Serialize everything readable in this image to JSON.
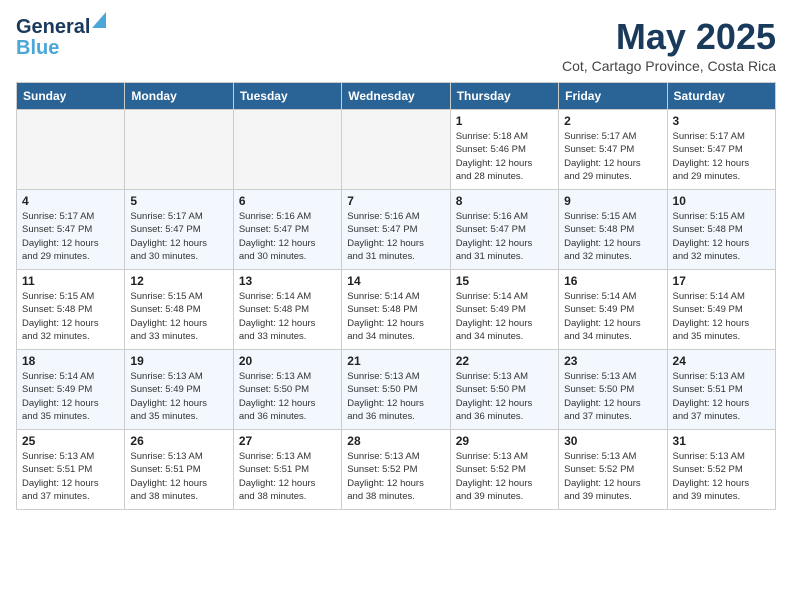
{
  "header": {
    "logo_line1": "General",
    "logo_line2": "Blue",
    "month": "May 2025",
    "location": "Cot, Cartago Province, Costa Rica"
  },
  "columns": [
    "Sunday",
    "Monday",
    "Tuesday",
    "Wednesday",
    "Thursday",
    "Friday",
    "Saturday"
  ],
  "weeks": [
    [
      {
        "day": "",
        "detail": ""
      },
      {
        "day": "",
        "detail": ""
      },
      {
        "day": "",
        "detail": ""
      },
      {
        "day": "",
        "detail": ""
      },
      {
        "day": "1",
        "detail": "Sunrise: 5:18 AM\nSunset: 5:46 PM\nDaylight: 12 hours\nand 28 minutes."
      },
      {
        "day": "2",
        "detail": "Sunrise: 5:17 AM\nSunset: 5:47 PM\nDaylight: 12 hours\nand 29 minutes."
      },
      {
        "day": "3",
        "detail": "Sunrise: 5:17 AM\nSunset: 5:47 PM\nDaylight: 12 hours\nand 29 minutes."
      }
    ],
    [
      {
        "day": "4",
        "detail": "Sunrise: 5:17 AM\nSunset: 5:47 PM\nDaylight: 12 hours\nand 29 minutes."
      },
      {
        "day": "5",
        "detail": "Sunrise: 5:17 AM\nSunset: 5:47 PM\nDaylight: 12 hours\nand 30 minutes."
      },
      {
        "day": "6",
        "detail": "Sunrise: 5:16 AM\nSunset: 5:47 PM\nDaylight: 12 hours\nand 30 minutes."
      },
      {
        "day": "7",
        "detail": "Sunrise: 5:16 AM\nSunset: 5:47 PM\nDaylight: 12 hours\nand 31 minutes."
      },
      {
        "day": "8",
        "detail": "Sunrise: 5:16 AM\nSunset: 5:47 PM\nDaylight: 12 hours\nand 31 minutes."
      },
      {
        "day": "9",
        "detail": "Sunrise: 5:15 AM\nSunset: 5:48 PM\nDaylight: 12 hours\nand 32 minutes."
      },
      {
        "day": "10",
        "detail": "Sunrise: 5:15 AM\nSunset: 5:48 PM\nDaylight: 12 hours\nand 32 minutes."
      }
    ],
    [
      {
        "day": "11",
        "detail": "Sunrise: 5:15 AM\nSunset: 5:48 PM\nDaylight: 12 hours\nand 32 minutes."
      },
      {
        "day": "12",
        "detail": "Sunrise: 5:15 AM\nSunset: 5:48 PM\nDaylight: 12 hours\nand 33 minutes."
      },
      {
        "day": "13",
        "detail": "Sunrise: 5:14 AM\nSunset: 5:48 PM\nDaylight: 12 hours\nand 33 minutes."
      },
      {
        "day": "14",
        "detail": "Sunrise: 5:14 AM\nSunset: 5:48 PM\nDaylight: 12 hours\nand 34 minutes."
      },
      {
        "day": "15",
        "detail": "Sunrise: 5:14 AM\nSunset: 5:49 PM\nDaylight: 12 hours\nand 34 minutes."
      },
      {
        "day": "16",
        "detail": "Sunrise: 5:14 AM\nSunset: 5:49 PM\nDaylight: 12 hours\nand 34 minutes."
      },
      {
        "day": "17",
        "detail": "Sunrise: 5:14 AM\nSunset: 5:49 PM\nDaylight: 12 hours\nand 35 minutes."
      }
    ],
    [
      {
        "day": "18",
        "detail": "Sunrise: 5:14 AM\nSunset: 5:49 PM\nDaylight: 12 hours\nand 35 minutes."
      },
      {
        "day": "19",
        "detail": "Sunrise: 5:13 AM\nSunset: 5:49 PM\nDaylight: 12 hours\nand 35 minutes."
      },
      {
        "day": "20",
        "detail": "Sunrise: 5:13 AM\nSunset: 5:50 PM\nDaylight: 12 hours\nand 36 minutes."
      },
      {
        "day": "21",
        "detail": "Sunrise: 5:13 AM\nSunset: 5:50 PM\nDaylight: 12 hours\nand 36 minutes."
      },
      {
        "day": "22",
        "detail": "Sunrise: 5:13 AM\nSunset: 5:50 PM\nDaylight: 12 hours\nand 36 minutes."
      },
      {
        "day": "23",
        "detail": "Sunrise: 5:13 AM\nSunset: 5:50 PM\nDaylight: 12 hours\nand 37 minutes."
      },
      {
        "day": "24",
        "detail": "Sunrise: 5:13 AM\nSunset: 5:51 PM\nDaylight: 12 hours\nand 37 minutes."
      }
    ],
    [
      {
        "day": "25",
        "detail": "Sunrise: 5:13 AM\nSunset: 5:51 PM\nDaylight: 12 hours\nand 37 minutes."
      },
      {
        "day": "26",
        "detail": "Sunrise: 5:13 AM\nSunset: 5:51 PM\nDaylight: 12 hours\nand 38 minutes."
      },
      {
        "day": "27",
        "detail": "Sunrise: 5:13 AM\nSunset: 5:51 PM\nDaylight: 12 hours\nand 38 minutes."
      },
      {
        "day": "28",
        "detail": "Sunrise: 5:13 AM\nSunset: 5:52 PM\nDaylight: 12 hours\nand 38 minutes."
      },
      {
        "day": "29",
        "detail": "Sunrise: 5:13 AM\nSunset: 5:52 PM\nDaylight: 12 hours\nand 39 minutes."
      },
      {
        "day": "30",
        "detail": "Sunrise: 5:13 AM\nSunset: 5:52 PM\nDaylight: 12 hours\nand 39 minutes."
      },
      {
        "day": "31",
        "detail": "Sunrise: 5:13 AM\nSunset: 5:52 PM\nDaylight: 12 hours\nand 39 minutes."
      }
    ]
  ]
}
